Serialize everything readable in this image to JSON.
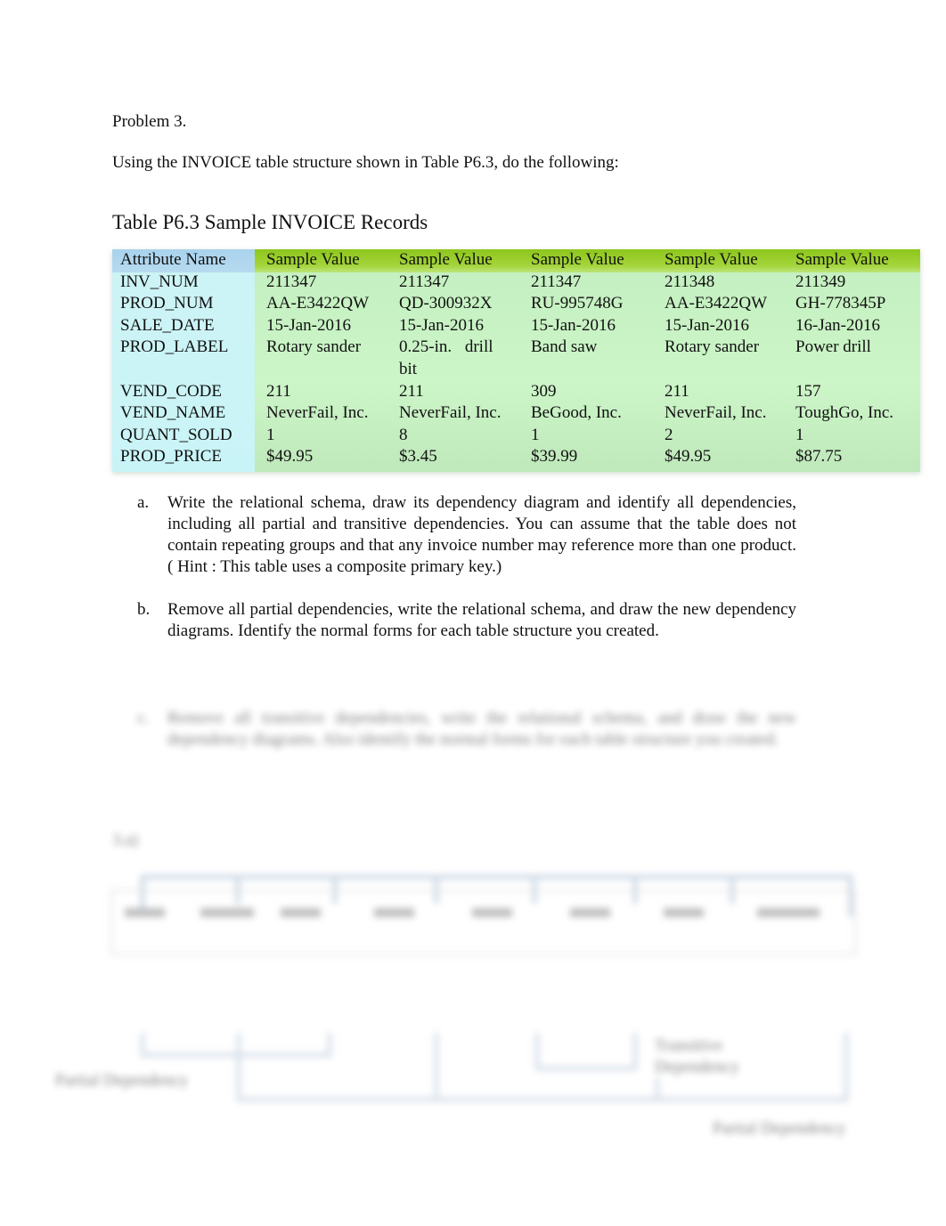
{
  "heading": "Problem 3.",
  "intro": "Using the INVOICE table structure shown in Table P6.3, do the following:",
  "table": {
    "caption": "Table P6.3 Sample INVOICE Records",
    "header": [
      "Attribute Name",
      "Sample Value",
      "Sample Value",
      "Sample Value",
      "Sample Value",
      "Sample Value"
    ],
    "rows": [
      {
        "attr": "INV_NUM",
        "values": [
          "211347",
          "211347",
          "211347",
          "211348",
          "211349"
        ]
      },
      {
        "attr": "PROD_NUM",
        "values": [
          "AA-E3422QW",
          "QD-300932X",
          "RU-995748G",
          "AA-E3422QW",
          "GH-778345P"
        ]
      },
      {
        "attr": "SALE_DATE",
        "values": [
          "15-Jan-2016",
          "15-Jan-2016",
          "15-Jan-2016",
          "15-Jan-2016",
          "16-Jan-2016"
        ]
      },
      {
        "attr": "PROD_LABEL",
        "values": [
          "Rotary sander",
          "0.25-in. drill bit",
          "Band saw",
          "Rotary sander",
          "Power drill"
        ]
      },
      {
        "attr": "VEND_CODE",
        "values": [
          "211",
          "211",
          "309",
          "211",
          "157"
        ]
      },
      {
        "attr": "VEND_NAME",
        "values": [
          "NeverFail, Inc.",
          "NeverFail, Inc.",
          "BeGood, Inc.",
          "NeverFail, Inc.",
          "ToughGo, Inc."
        ]
      },
      {
        "attr": "QUANT_SOLD",
        "values": [
          "1",
          "8",
          "1",
          "2",
          "1"
        ]
      },
      {
        "attr": "PROD_PRICE",
        "values": [
          "$49.95",
          "$3.45",
          "$39.99",
          "$49.95",
          "$87.75"
        ]
      }
    ],
    "colors": {
      "attr_header": "#a9d2ec",
      "attr_body": "#cdf3f5",
      "value_header": "#8dc61c",
      "value_body": "#c6f1c2"
    }
  },
  "tasks": [
    {
      "marker": "a.",
      "text": "Write the relational schema, draw its dependency diagram and identify all dependencies, including all partial and transitive dependencies. You can assume that the table does not contain repeating groups and that any invoice number may reference more than one product. (    Hint : This table uses a composite primary key.)"
    },
    {
      "marker": "b.",
      "text": "Remove all partial dependencies, write the relational schema, and draw the new dependency diagrams. Identify the normal forms for each table structure you created."
    },
    {
      "marker": "c.",
      "text": "Remove all transitive dependencies, write the relational schema, and draw the new dependency diagrams. Also identify the normal forms for each table structure you created."
    }
  ],
  "blurred": {
    "answer_label": "3.a)",
    "diagram_labels": [
      "Partial Dependency",
      "Transitive Dependency",
      "Partial Dependency"
    ]
  }
}
